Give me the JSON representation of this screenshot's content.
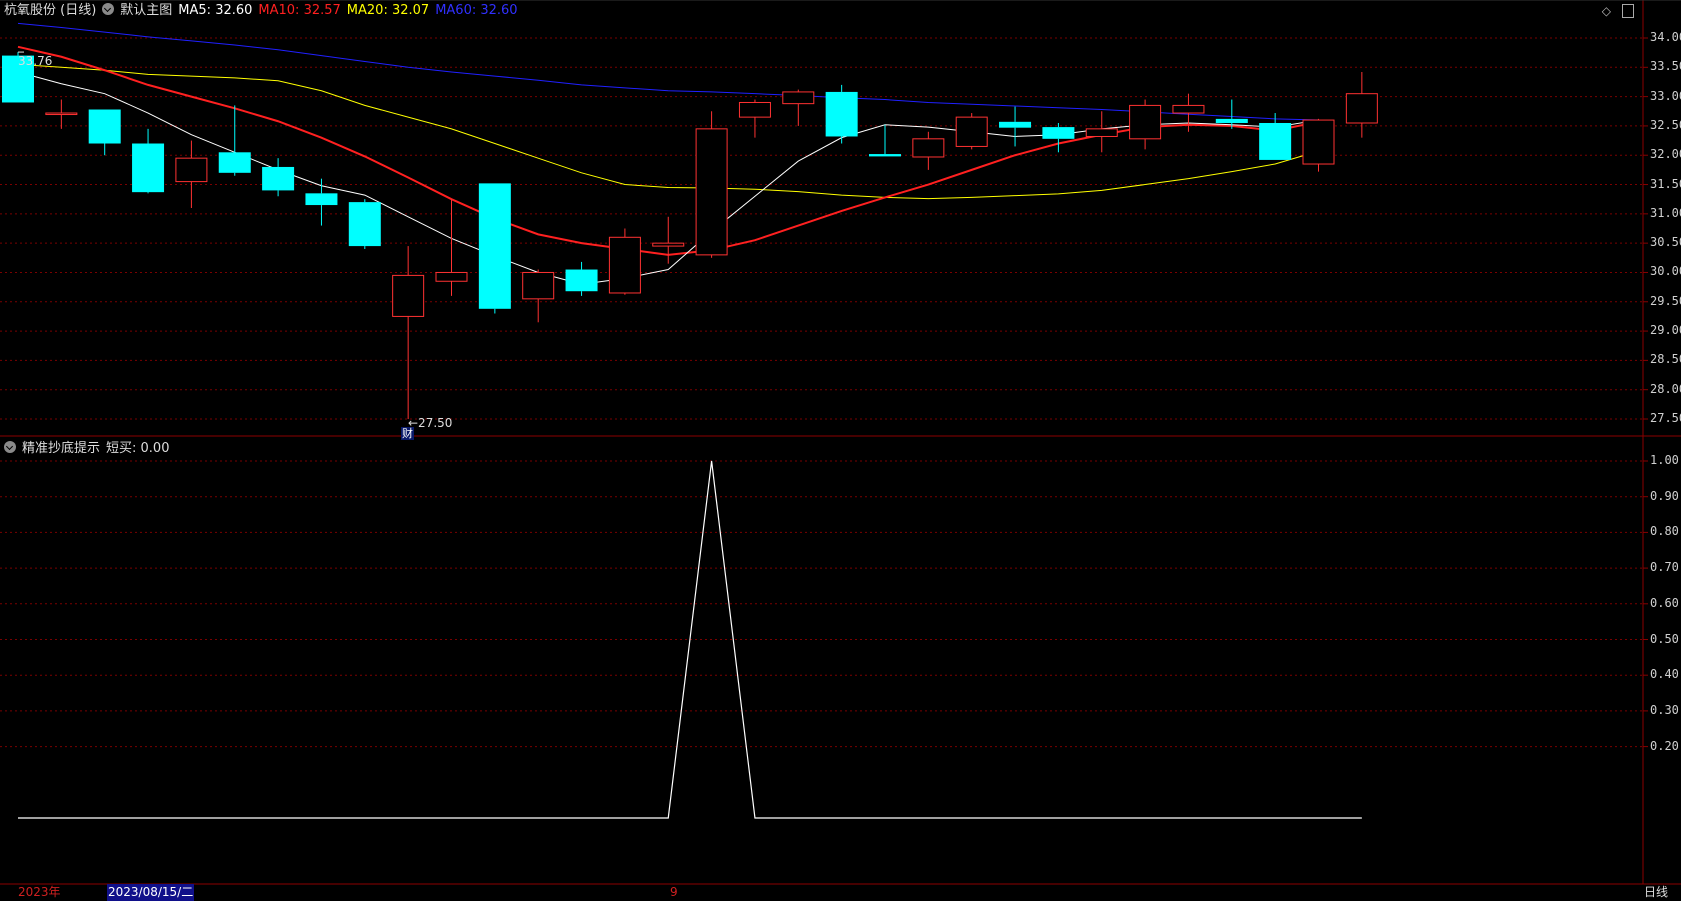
{
  "main_header": {
    "title": "杭氧股份 (日线)",
    "template": "默认主图",
    "ma5": "MA5: 32.60",
    "ma10": "MA10: 32.57",
    "ma20": "MA20: 32.07",
    "ma60": "MA60: 32.60"
  },
  "sub_header": {
    "indicator": "精准抄底提示",
    "value": "短买: 0.00"
  },
  "price_axis": [
    "34.00",
    "33.50",
    "33.00",
    "32.50",
    "32.00",
    "31.50",
    "31.00",
    "30.50",
    "30.00",
    "29.50",
    "29.00",
    "28.50",
    "28.00",
    "27.50"
  ],
  "indicator_axis": [
    "1.00",
    "0.90",
    "0.80",
    "0.70",
    "0.60",
    "0.50",
    "0.40",
    "0.30",
    "0.20"
  ],
  "annotations": {
    "high": "33.76",
    "low": "←27.50",
    "event_marker": "财"
  },
  "bottom": {
    "year": "2023年",
    "cursor_date": "2023/08/15/二",
    "month_marker": "9",
    "period": "日线"
  },
  "colors": {
    "up": "#ff3232",
    "down": "#00ffff",
    "ma5": "#ffffff",
    "ma10": "#ff2020",
    "ma20": "#ffff00",
    "ma60": "#2020ff",
    "grid": "#7a0000",
    "axis": "#8b0000"
  },
  "chart_data": [
    {
      "type": "candlestick",
      "title": "杭氧股份 (日线)",
      "ylim": [
        27.25,
        34.1
      ],
      "candles": [
        {
          "o": 33.7,
          "h": 33.76,
          "l": 32.9,
          "c": 32.9
        },
        {
          "o": 32.72,
          "h": 32.95,
          "l": 32.45,
          "c": 32.72
        },
        {
          "o": 32.78,
          "h": 32.78,
          "l": 32.0,
          "c": 32.2
        },
        {
          "o": 32.2,
          "h": 32.45,
          "l": 31.35,
          "c": 31.37
        },
        {
          "o": 31.55,
          "h": 32.25,
          "l": 31.1,
          "c": 31.95
        },
        {
          "o": 32.05,
          "h": 32.85,
          "l": 31.65,
          "c": 31.7
        },
        {
          "o": 31.8,
          "h": 31.95,
          "l": 31.3,
          "c": 31.4
        },
        {
          "o": 31.35,
          "h": 31.6,
          "l": 30.8,
          "c": 31.15
        },
        {
          "o": 31.2,
          "h": 31.25,
          "l": 30.4,
          "c": 30.45
        },
        {
          "o": 29.25,
          "h": 30.45,
          "l": 27.5,
          "c": 29.95
        },
        {
          "o": 29.85,
          "h": 31.25,
          "l": 29.6,
          "c": 30.0
        },
        {
          "o": 31.52,
          "h": 31.52,
          "l": 29.3,
          "c": 29.38
        },
        {
          "o": 29.55,
          "h": 30.05,
          "l": 29.15,
          "c": 30.0
        },
        {
          "o": 30.05,
          "h": 30.18,
          "l": 29.6,
          "c": 29.68
        },
        {
          "o": 29.65,
          "h": 30.75,
          "l": 29.62,
          "c": 30.6
        },
        {
          "o": 30.45,
          "h": 30.95,
          "l": 30.15,
          "c": 30.5
        },
        {
          "o": 30.3,
          "h": 32.75,
          "l": 30.25,
          "c": 32.45
        },
        {
          "o": 32.65,
          "h": 32.95,
          "l": 32.3,
          "c": 32.9
        },
        {
          "o": 32.88,
          "h": 33.12,
          "l": 32.5,
          "c": 33.08
        },
        {
          "o": 33.08,
          "h": 33.2,
          "l": 32.2,
          "c": 32.32
        },
        {
          "o": 32.02,
          "h": 32.52,
          "l": 31.98,
          "c": 31.98
        },
        {
          "o": 31.97,
          "h": 32.4,
          "l": 31.75,
          "c": 32.28
        },
        {
          "o": 32.15,
          "h": 32.72,
          "l": 32.1,
          "c": 32.65
        },
        {
          "o": 32.57,
          "h": 32.83,
          "l": 32.15,
          "c": 32.47
        },
        {
          "o": 32.48,
          "h": 32.55,
          "l": 32.05,
          "c": 32.28
        },
        {
          "o": 32.32,
          "h": 32.75,
          "l": 32.05,
          "c": 32.45
        },
        {
          "o": 32.28,
          "h": 32.95,
          "l": 32.1,
          "c": 32.85
        },
        {
          "o": 32.72,
          "h": 33.05,
          "l": 32.4,
          "c": 32.85
        },
        {
          "o": 32.62,
          "h": 32.95,
          "l": 32.45,
          "c": 32.55
        },
        {
          "o": 32.55,
          "h": 32.72,
          "l": 31.92,
          "c": 31.92
        },
        {
          "o": 31.85,
          "h": 32.62,
          "l": 31.72,
          "c": 32.6
        },
        {
          "o": 32.55,
          "h": 33.42,
          "l": 32.3,
          "c": 33.05
        }
      ],
      "ma5": [
        33.42,
        33.22,
        33.05,
        32.72,
        32.35,
        32.05,
        31.75,
        31.48,
        31.32,
        30.95,
        30.58,
        30.28,
        30.0,
        29.8,
        29.9,
        30.05,
        30.7,
        31.3,
        31.9,
        32.3,
        32.52,
        32.48,
        32.4,
        32.32,
        32.35,
        32.45,
        32.52,
        32.55,
        32.52,
        32.48,
        32.6
      ],
      "ma10": [
        33.85,
        33.68,
        33.45,
        33.2,
        33.0,
        32.8,
        32.58,
        32.3,
        31.98,
        31.62,
        31.25,
        30.92,
        30.65,
        30.5,
        30.4,
        30.3,
        30.38,
        30.55,
        30.8,
        31.05,
        31.28,
        31.5,
        31.75,
        32.0,
        32.2,
        32.35,
        32.48,
        32.52,
        32.5,
        32.42,
        32.57
      ],
      "ma20": [
        33.55,
        33.5,
        33.45,
        33.38,
        33.35,
        33.32,
        33.27,
        33.1,
        32.85,
        32.65,
        32.45,
        32.2,
        31.95,
        31.7,
        31.5,
        31.45,
        31.44,
        31.42,
        31.38,
        31.32,
        31.28,
        31.26,
        31.28,
        31.31,
        31.34,
        31.4,
        31.5,
        31.6,
        31.72,
        31.85,
        32.07
      ],
      "ma60": [
        34.25,
        34.18,
        34.1,
        34.02,
        33.95,
        33.88,
        33.8,
        33.7,
        33.6,
        33.5,
        33.42,
        33.35,
        33.28,
        33.2,
        33.15,
        33.1,
        33.08,
        33.05,
        33.02,
        32.98,
        32.95,
        32.9,
        32.87,
        32.84,
        32.81,
        32.78,
        32.74,
        32.7,
        32.66,
        32.62,
        32.6
      ]
    },
    {
      "type": "line",
      "title": "精准抄底提示",
      "series": [
        {
          "name": "短买",
          "values": [
            0,
            0,
            0,
            0,
            0,
            0,
            0,
            0,
            0,
            0,
            0,
            0,
            0,
            0,
            0,
            0,
            1,
            0,
            0,
            0,
            0,
            0,
            0,
            0,
            0,
            0,
            0,
            0,
            0,
            0,
            0,
            0
          ]
        }
      ],
      "ylim": [
        0,
        1.05
      ]
    }
  ]
}
